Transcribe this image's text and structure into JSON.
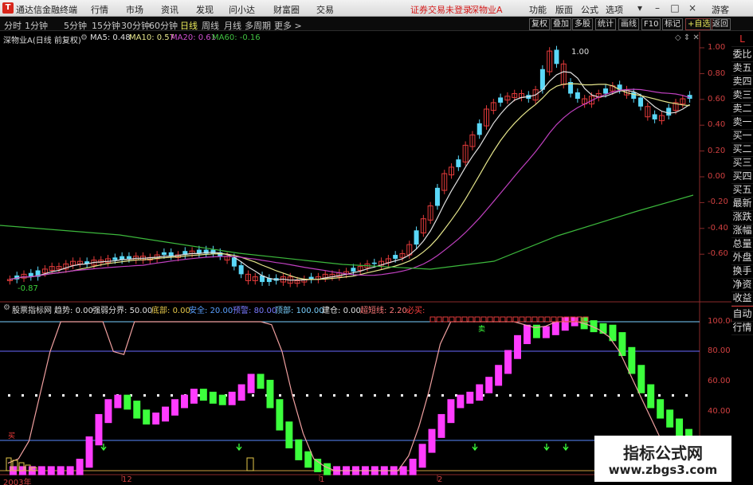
{
  "menubar": {
    "app_title": "通达信金融终端",
    "menus": [
      "行情",
      "市场",
      "资讯",
      "发现",
      "问小达",
      "财富圈",
      "交易"
    ],
    "notice": "证券交易未登录",
    "notice_stock": "深物业A",
    "right_menus": [
      "功能",
      "版面",
      "公式",
      "选项"
    ],
    "user": "游客"
  },
  "periodbar": {
    "periods": [
      "分时",
      "1分钟",
      "5分钟",
      "15分钟",
      "30分钟",
      "60分钟",
      "日线",
      "周线",
      "月线",
      "多周期",
      "更多 >"
    ],
    "active_period": "日线",
    "tools": [
      "复权",
      "叠加",
      "多股",
      "统计",
      "画线",
      "F10",
      "标记",
      "+自选",
      "返回"
    ]
  },
  "main_chart": {
    "stock_label": "深物业A(日线 前复权)",
    "ma": [
      {
        "label": "MA5:",
        "value": "0.48",
        "color": "#e0e0e0"
      },
      {
        "label": "MA10:",
        "value": "0.57",
        "color": "#e6e68c"
      },
      {
        "label": "MA20:",
        "value": "0.61",
        "color": "#d050d0"
      },
      {
        "label": "MA60:",
        "value": "-0.16",
        "color": "#40c040"
      }
    ],
    "high_mark": "1.00",
    "low_mark": "-0.87",
    "y_ticks": [
      "1.00",
      "0.80",
      "0.60",
      "0.40",
      "0.20",
      "0.00",
      "-0.20",
      "-0.40",
      "-0.60"
    ]
  },
  "indicator": {
    "name": "股票指标网",
    "items": [
      {
        "label": "趋势:",
        "value": "0.00",
        "color": "#e0e0e0"
      },
      {
        "label": "强弱分界:",
        "value": "50.00",
        "color": "#e0e0e0"
      },
      {
        "label": "底部:",
        "value": "0.00",
        "color": "#e6c84a"
      },
      {
        "label": "安全:",
        "value": "20.00",
        "color": "#5aa0ff"
      },
      {
        "label": "预警:",
        "value": "80.00",
        "color": "#7a7aff"
      },
      {
        "label": "顶部:",
        "value": "100.00",
        "color": "#7ad0ff"
      },
      {
        "label": "建仓:",
        "value": "0.00",
        "color": "#e0e0e0"
      },
      {
        "label": "超短线:",
        "value": "2.20",
        "color": "#ff7a7a"
      },
      {
        "label": "必买:",
        "value": "",
        "color": "#ff4040"
      }
    ],
    "y_ticks": [
      "100.00",
      "80.00",
      "60.00",
      "40.00"
    ],
    "buy_tag": "买",
    "sell_tag": "卖"
  },
  "x_axis": {
    "labels": [
      "2003年",
      "12",
      "1",
      "2"
    ]
  },
  "side_buttons": [
    "委比",
    "卖五",
    "卖四",
    "卖三",
    "卖二",
    "卖一",
    "买一",
    "买二",
    "买三",
    "买四",
    "买五",
    "最新",
    "涨跌",
    "涨幅",
    "总量",
    "外盘",
    "换手",
    "净资",
    "收益"
  ],
  "side_top": "L",
  "side_bottom": [
    "自动",
    "行情"
  ],
  "watermark": {
    "title": "指标公式网",
    "url": "www.zbgs3.com"
  },
  "colors": {
    "up": "#e23a3a",
    "down": "#5ad8f8",
    "ma5": "#e0e0e0",
    "ma10": "#e6e68c",
    "ma20": "#c040c0",
    "ma60": "#3cb83c",
    "osc_up": "#ff3cff",
    "osc_down": "#3cff3c",
    "trend": "#f0a0a0"
  }
}
